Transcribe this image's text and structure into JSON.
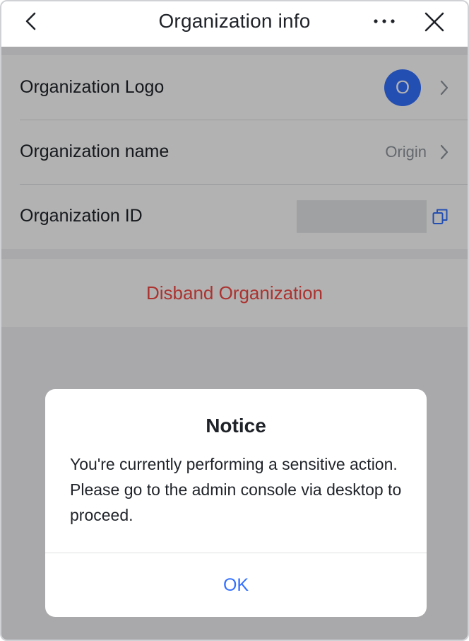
{
  "navbar": {
    "title": "Organization info",
    "back_icon": "chevron-left-icon",
    "more_icon": "more-horizontal-icon",
    "close_icon": "close-icon"
  },
  "settings": {
    "logo": {
      "label": "Organization Logo",
      "avatar_letter": "O",
      "avatar_color": "#3370ff"
    },
    "name": {
      "label": "Organization name",
      "value": "Origin"
    },
    "id": {
      "label": "Organization ID",
      "copy_icon": "copy-icon"
    }
  },
  "danger": {
    "disband_label": "Disband Organization",
    "color": "#f54a45"
  },
  "dialog": {
    "title": "Notice",
    "message": "You're currently performing a sensitive action. Please go to the admin console via desktop to proceed.",
    "ok_label": "OK",
    "ok_color": "#3370ff"
  }
}
